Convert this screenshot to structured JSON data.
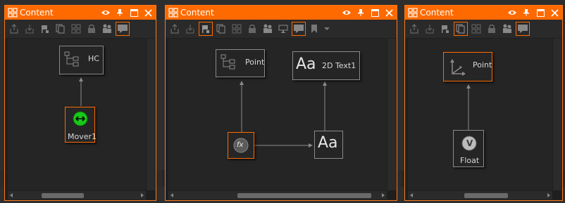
{
  "panels": [
    {
      "title": "Content",
      "nodes": {
        "hc_label": "HC",
        "mover_label": "Mover1"
      }
    },
    {
      "title": "Content",
      "nodes": {
        "point_label": "Point",
        "text_glyph": "Aa",
        "text_label": "2D Text1",
        "fx_glyph": "fx",
        "out_glyph": "Aa"
      }
    },
    {
      "title": "Content",
      "nodes": {
        "point_label": "Point",
        "float_glyph": "V",
        "float_label": "Float"
      }
    }
  ],
  "colors": {
    "accent": "#ff6a00",
    "panel_bg": "#1f1f1f",
    "toolbar_bg": "#2a2a2a",
    "link": "#8a8a8a"
  },
  "icons": {
    "title": "grid-window-icon",
    "titlebar_buttons": [
      "eye-icon",
      "pin-icon",
      "maximize-icon",
      "close-icon"
    ]
  }
}
